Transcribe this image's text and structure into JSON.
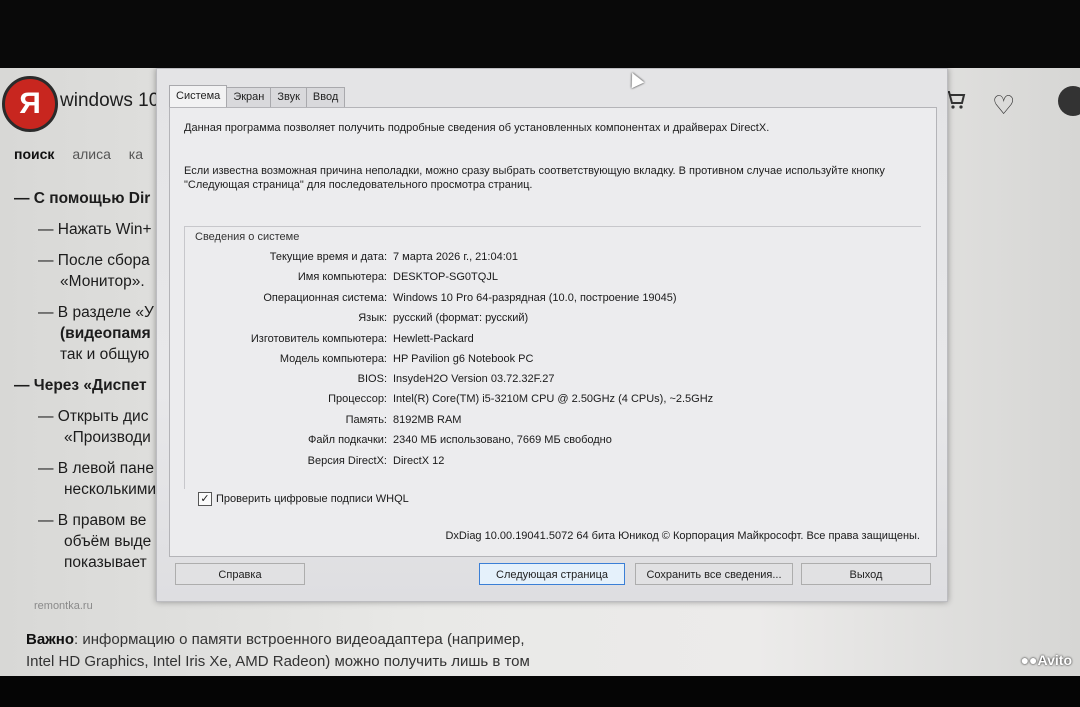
{
  "background_page": {
    "search_query": "windows 10",
    "logo_letter": "Я",
    "tabs": [
      "поиск",
      "алиса",
      "ка"
    ],
    "article_lines": [
      "— С помощью Dir",
      "— Нажать Win+",
      "— После сбора",
      "«Монитор».",
      "— В разделе «У",
      "(видеопамя",
      "так и общую",
      "— Через «Диспет",
      "— Открыть дис",
      "«Производи",
      "— В левой пане",
      "несколькими",
      "— В правом ве",
      "объём выде",
      "показывает"
    ],
    "source": "remontka.ru",
    "note_bold": "Важно",
    "note_text1": ": информацию о памяти встроенного видеоадаптера (например,",
    "note_text2": "Intel HD Graphics, Intel Iris Xe, AMD Radeon) можно получить лишь в том",
    "watermark": "Avito"
  },
  "dialog": {
    "tabs": [
      "Система",
      "Экран",
      "Звук",
      "Ввод"
    ],
    "intro1": "Данная программа позволяет получить подробные сведения об установленных компонентах и драйверах DirectX.",
    "intro2": "Если известна возможная причина неполадки, можно сразу выбрать соответствующую вкладку. В противном случае используйте кнопку \"Следующая страница\" для последовательного просмотра страниц.",
    "group_title": "Сведения о системе",
    "rows": [
      {
        "label": "Текущие время и дата:",
        "value": "7 марта 2026 г., 21:04:01"
      },
      {
        "label": "Имя компьютера:",
        "value": "DESKTOP-SG0TQJL"
      },
      {
        "label": "Операционная система:",
        "value": "Windows 10 Pro 64-разрядная (10.0, построение 19045)"
      },
      {
        "label": "Язык:",
        "value": "русский (формат: русский)"
      },
      {
        "label": "Изготовитель компьютера:",
        "value": "Hewlett-Packard"
      },
      {
        "label": "Модель компьютера:",
        "value": "HP Pavilion g6 Notebook PC"
      },
      {
        "label": "BIOS:",
        "value": "InsydeH2O Version 03.72.32F.27"
      },
      {
        "label": "Процессор:",
        "value": "Intel(R) Core(TM) i5-3210M CPU @ 2.50GHz (4 CPUs), ~2.5GHz"
      },
      {
        "label": "Память:",
        "value": "8192MB RAM"
      },
      {
        "label": "Файл подкачки:",
        "value": "2340 МБ использовано, 7669 МБ свободно"
      },
      {
        "label": "Версия DirectX:",
        "value": "DirectX 12"
      }
    ],
    "whql_label": "Проверить цифровые подписи WHQL",
    "whql_checked": true,
    "copyright": "DxDiag 10.00.19041.5072 64 бита Юникод © Корпорация Майкрософт. Все права защищены.",
    "buttons": {
      "help": "Справка",
      "next": "Следующая страница",
      "save": "Сохранить все сведения...",
      "exit": "Выход"
    }
  }
}
